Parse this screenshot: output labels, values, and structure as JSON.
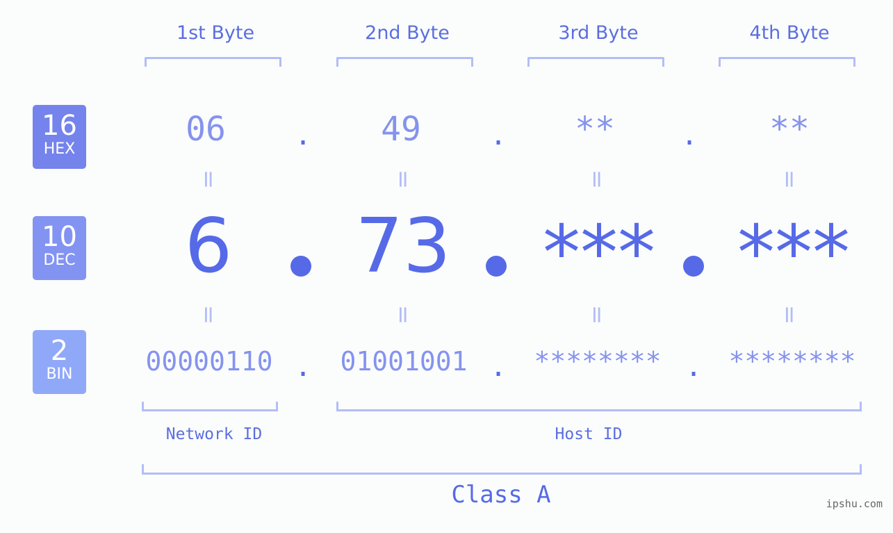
{
  "columns": [
    "1st Byte",
    "2nd Byte",
    "3rd Byte",
    "4th Byte"
  ],
  "badges": [
    {
      "number": "16",
      "label": "HEX",
      "color": "#7583ec"
    },
    {
      "number": "10",
      "label": "DEC",
      "color": "#8393f2"
    },
    {
      "number": "2",
      "label": "BIN",
      "color": "#90a8f8"
    }
  ],
  "hex": [
    "06",
    "49",
    "**",
    "**"
  ],
  "dec": [
    "6",
    "73",
    "***",
    "***"
  ],
  "bin": [
    "00000110",
    "01001001",
    "********",
    "********"
  ],
  "separator": ".",
  "equals": "=",
  "network_id_label": "Network ID",
  "host_id_label": "Host ID",
  "class_label": "Class A",
  "site": "ipshu.com",
  "colors": {
    "primary": "#566ae8",
    "light": "#8593ee",
    "bracket": "#b3bdf6"
  }
}
